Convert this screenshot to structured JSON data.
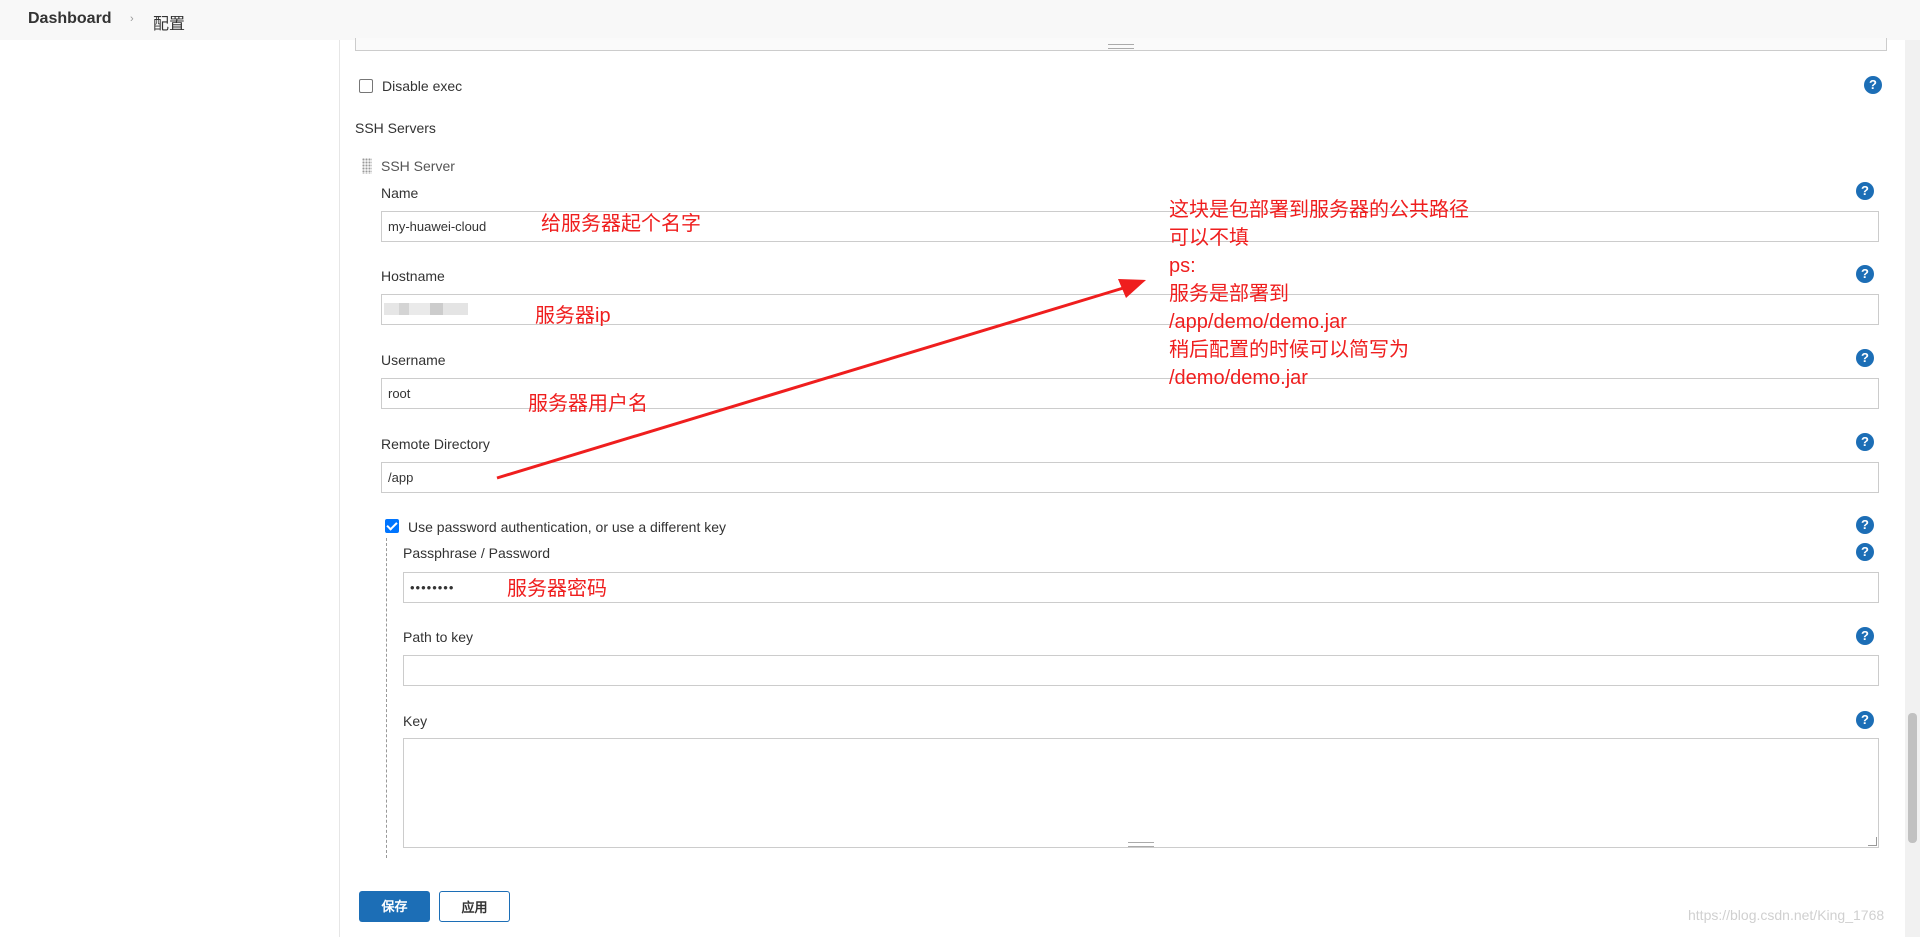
{
  "breadcrumb": {
    "dashboard": "Dashboard",
    "separator": "›",
    "current": "配置"
  },
  "form": {
    "disable_exec_label": "Disable exec",
    "ssh_servers_heading": "SSH Servers",
    "ssh_server_subheading": "SSH Server",
    "name_label": "Name",
    "name_value": "my-huawei-cloud",
    "hostname_label": "Hostname",
    "username_label": "Username",
    "username_value": "root",
    "remote_dir_label": "Remote Directory",
    "remote_dir_value": "/app",
    "use_password_label": "Use password authentication, or use a different key",
    "passphrase_label": "Passphrase / Password",
    "passphrase_value": "••••••••",
    "path_to_key_label": "Path to key",
    "key_label": "Key",
    "help_icon_glyph": "?"
  },
  "annotations": {
    "name": "给服务器起个名字",
    "hostname": "服务器ip",
    "username": "服务器用户名",
    "password": "服务器密码",
    "remote_dir_lines": [
      "这块是包部署到服务器的公共路径",
      "可以不填",
      "ps:",
      "服务是部署到",
      "/app/demo/demo.jar",
      "稍后配置的时候可以简写为",
      "/demo/demo.jar"
    ],
    "color": "#ef1e1e"
  },
  "buttons": {
    "save": "保存",
    "apply": "应用"
  },
  "watermark": "https://blog.csdn.net/King_1768",
  "colors": {
    "accent": "#1c6eb6",
    "annotation": "#ef1e1e"
  }
}
